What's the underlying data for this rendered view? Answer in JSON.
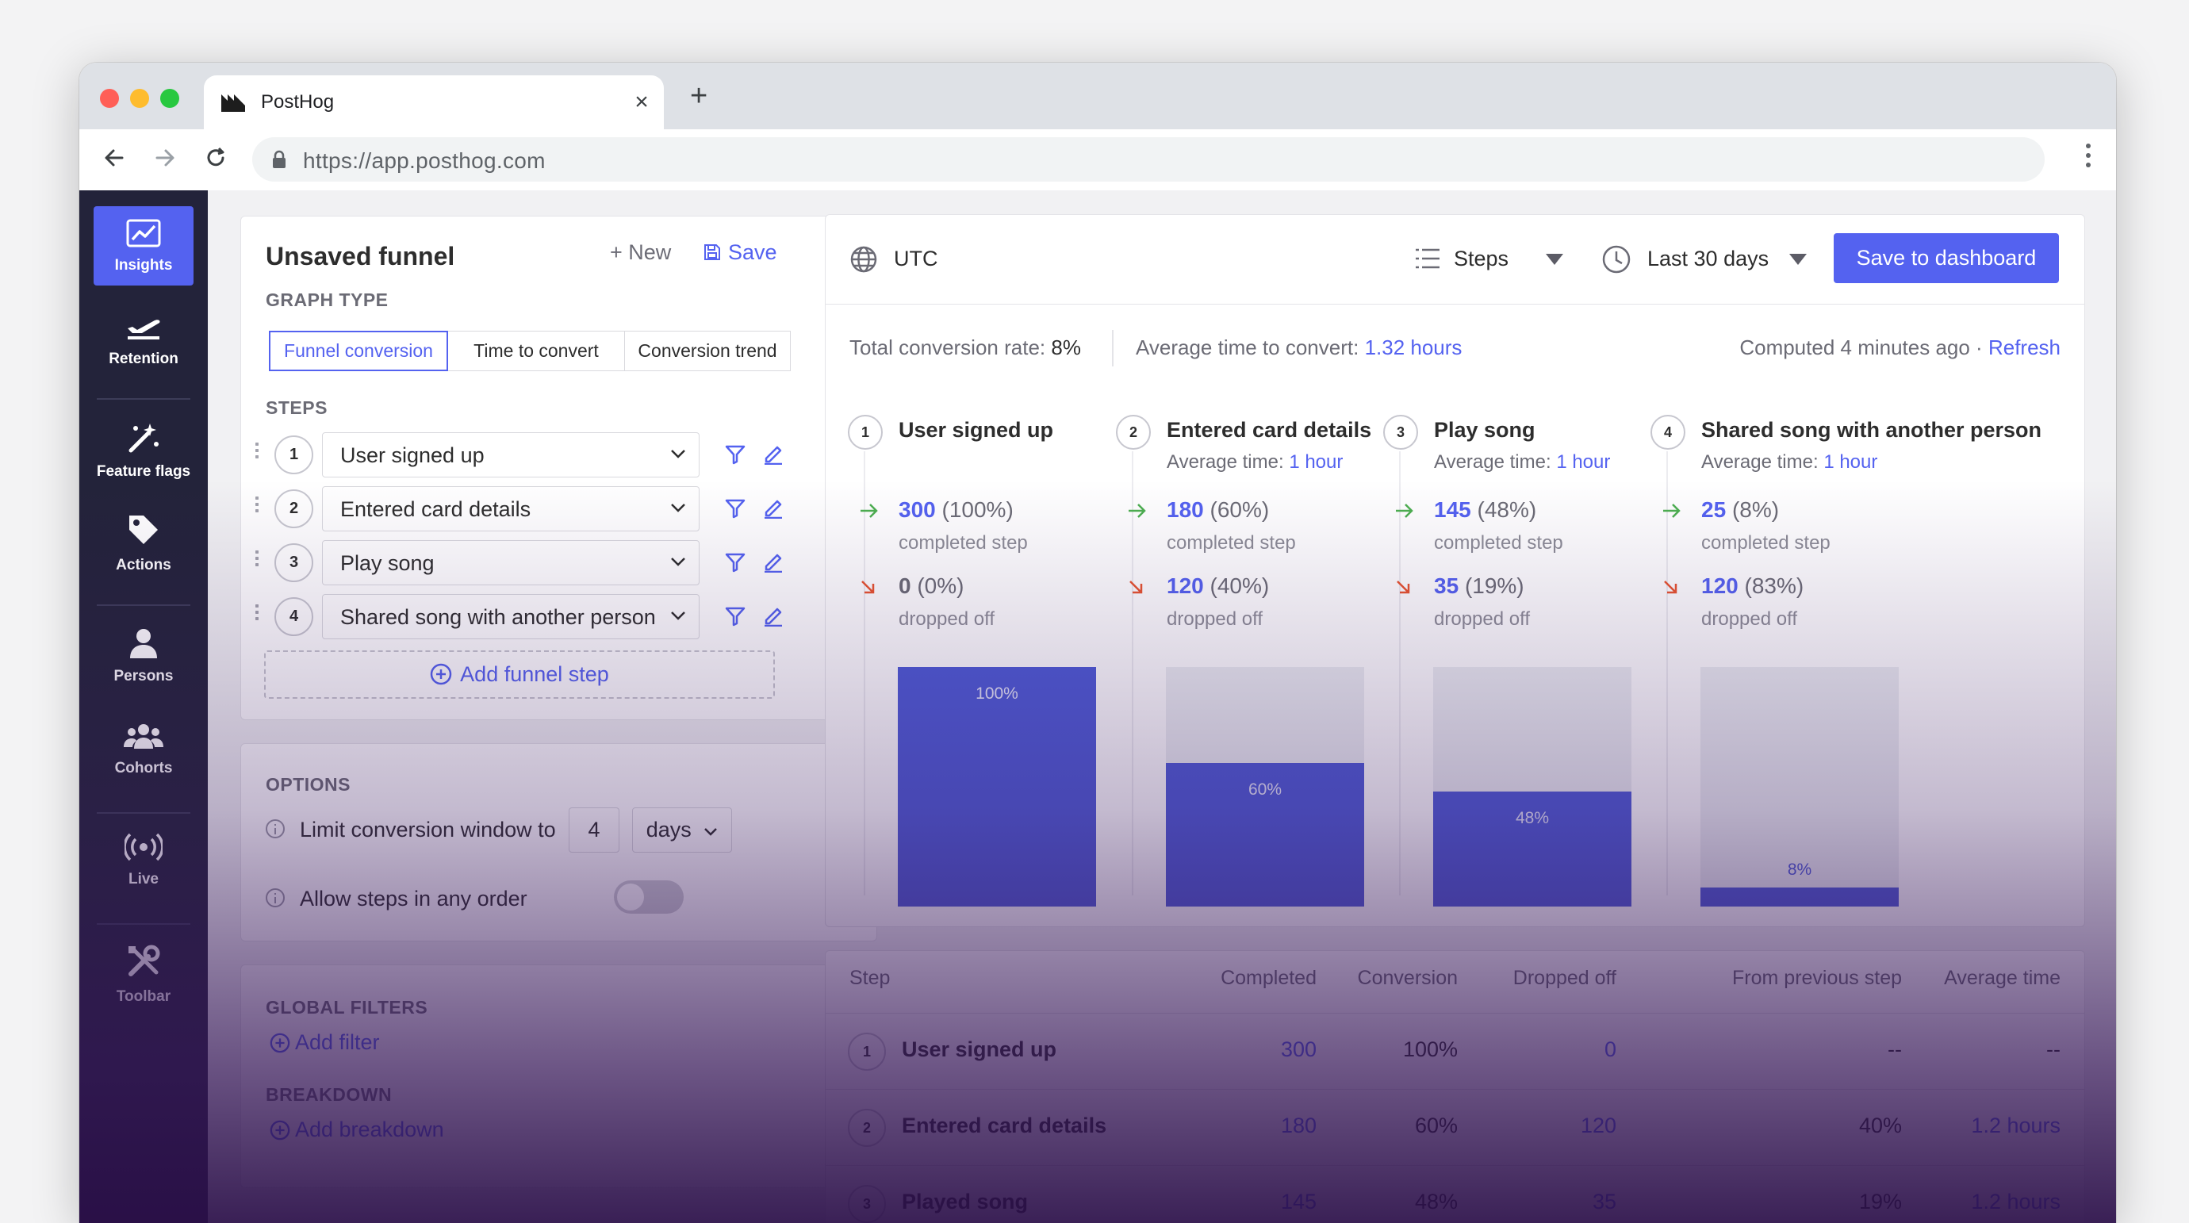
{
  "browser": {
    "tab_title": "PostHog",
    "close_glyph": "×",
    "new_tab_glyph": "+",
    "url": "https://app.posthog.com"
  },
  "sidebar": {
    "items": [
      {
        "label": "Insights",
        "icon": "insights-chart-icon",
        "active": true
      },
      {
        "label": "Retention",
        "icon": "plane-icon"
      },
      {
        "label": "Feature flags",
        "icon": "magic-wand-icon"
      },
      {
        "label": "Actions",
        "icon": "tag-icon"
      },
      {
        "label": "Persons",
        "icon": "person-icon"
      },
      {
        "label": "Cohorts",
        "icon": "group-icon"
      },
      {
        "label": "Live",
        "icon": "broadcast-icon"
      },
      {
        "label": "Toolbar",
        "icon": "tools-icon"
      }
    ]
  },
  "builder": {
    "title": "Unsaved funnel",
    "new_label": "+ New",
    "save_label": "Save",
    "graph_type_label": "GRAPH TYPE",
    "graph_types": [
      "Funnel conversion",
      "Time to convert",
      "Conversion trend"
    ],
    "steps_label": "STEPS",
    "steps": [
      {
        "num": "1",
        "event": "User signed up"
      },
      {
        "num": "2",
        "event": "Entered card details"
      },
      {
        "num": "3",
        "event": "Play song"
      },
      {
        "num": "4",
        "event": "Shared song with another person"
      }
    ],
    "add_step_label": "Add funnel step"
  },
  "options": {
    "label": "OPTIONS",
    "window_label": "Limit conversion window to",
    "window_value": "4",
    "window_unit": "days",
    "any_order_label": "Allow steps in any order",
    "any_order_enabled": false
  },
  "filters": {
    "global_label": "GLOBAL FILTERS",
    "add_filter": "Add filter",
    "breakdown_label": "BREAKDOWN",
    "add_breakdown": "Add breakdown"
  },
  "topbar": {
    "timezone": "UTC",
    "display_mode": "Steps",
    "date_range": "Last 30 days",
    "save_to_dashboard": "Save to dashboard"
  },
  "stats": {
    "total_label": "Total conversion rate:",
    "total_value": "8%",
    "avg_label": "Average time to convert:",
    "avg_value": "1.32 hours",
    "computed": "Computed 4 minutes ago ·",
    "refresh": "Refresh"
  },
  "funnel": {
    "avg_prefix": "Average time:",
    "completed_sub": "completed step",
    "dropped_sub": "dropped off",
    "steps": [
      {
        "num": "1",
        "name": "User signed up",
        "avg": "",
        "completed": "300",
        "completed_pct": "(100%)",
        "dropped": "0",
        "dropped_pct": "(0%)",
        "bar_label": "100%"
      },
      {
        "num": "2",
        "name": "Entered card details",
        "avg": "1 hour",
        "completed": "180",
        "completed_pct": "(60%)",
        "dropped": "120",
        "dropped_pct": "(40%)",
        "bar_label": "60%"
      },
      {
        "num": "3",
        "name": "Play song",
        "avg": "1 hour",
        "completed": "145",
        "completed_pct": "(48%)",
        "dropped": "35",
        "dropped_pct": "(19%)",
        "bar_label": "48%"
      },
      {
        "num": "4",
        "name": "Shared song with another person",
        "avg": "1 hour",
        "completed": "25",
        "completed_pct": "(8%)",
        "dropped": "120",
        "dropped_pct": "(83%)",
        "bar_label": "8%"
      }
    ]
  },
  "table": {
    "headers": [
      "Step",
      "Completed",
      "Conversion",
      "Dropped off",
      "From previous step",
      "Average time"
    ],
    "rows": [
      {
        "num": "1",
        "step": "User signed up",
        "completed": "300",
        "conversion": "100%",
        "dropped": "0",
        "from_prev": "--",
        "avg_time": "--"
      },
      {
        "num": "2",
        "step": "Entered card details",
        "completed": "180",
        "conversion": "60%",
        "dropped": "120",
        "from_prev": "40%",
        "avg_time": "1.2 hours"
      },
      {
        "num": "3",
        "step": "Played song",
        "completed": "145",
        "conversion": "48%",
        "dropped": "35",
        "from_prev": "19%",
        "avg_time": "1.2 hours"
      }
    ]
  },
  "colors": {
    "primary": "#5462f0",
    "bar": "#4e5bd6",
    "sidebar": "#23233a",
    "overlay": "#2c124a"
  }
}
